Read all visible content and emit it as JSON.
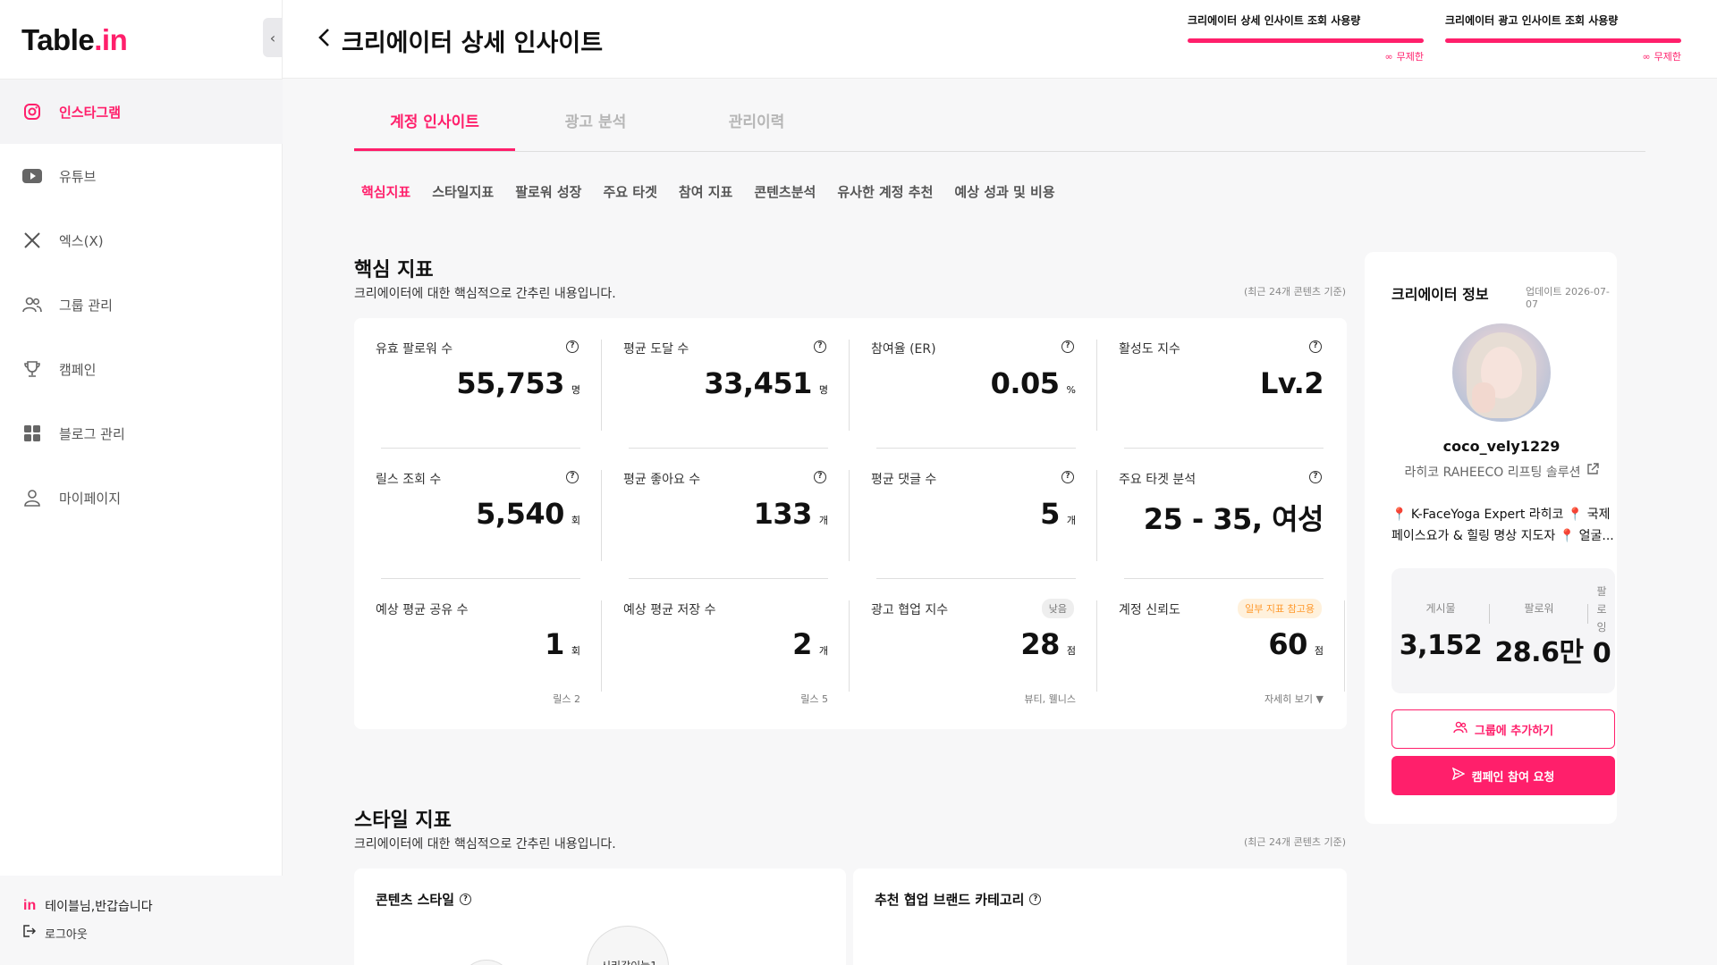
{
  "app": {
    "logo_main": "Table",
    "logo_dot": ".",
    "logo_suffix": "in"
  },
  "sidebar": {
    "items": [
      {
        "label": "인스타그램",
        "icon": "instagram-icon"
      },
      {
        "label": "유튜브",
        "icon": "youtube-icon"
      },
      {
        "label": "엑스(X)",
        "icon": "x-icon"
      },
      {
        "label": "그룹 관리",
        "icon": "group-icon"
      },
      {
        "label": "캠페인",
        "icon": "trophy-icon"
      },
      {
        "label": "블로그 관리",
        "icon": "grid-icon"
      },
      {
        "label": "마이페이지",
        "icon": "user-icon"
      }
    ],
    "active_index": 0,
    "footer": {
      "mini_logo": "in",
      "greeting": "테이블님,반갑습니다",
      "logout": "로그아웃"
    }
  },
  "header": {
    "title": "크리에이터 상세 인사이트",
    "usage": [
      {
        "label": "크리에이터 상세 인사이트 조회 사용량",
        "value": "무제한",
        "fill": 1.0
      },
      {
        "label": "크리에이터 광고 인사이트 조회 사용량",
        "value": "무제한",
        "fill": 1.0
      }
    ]
  },
  "tabs": [
    {
      "label": "계정 인사이트",
      "active": true
    },
    {
      "label": "광고 분석",
      "active": false
    },
    {
      "label": "관리이력",
      "active": false
    }
  ],
  "subtabs": [
    {
      "label": "핵심지표",
      "active": true
    },
    {
      "label": "스타일지표",
      "active": false
    },
    {
      "label": "팔로워 성장",
      "active": false
    },
    {
      "label": "주요 타겟",
      "active": false
    },
    {
      "label": "참여 지표",
      "active": false
    },
    {
      "label": "콘텐츠분석",
      "active": false
    },
    {
      "label": "유사한 계정 추천",
      "active": false
    },
    {
      "label": "예상 성과 및 비용",
      "active": false
    }
  ],
  "core": {
    "title": "핵심 지표",
    "desc": "크리에이터에 대한 핵심적으로 간추린 내용입니다.",
    "note": "(최근 24개 콘텐츠 기준)",
    "metrics": [
      {
        "label": "유효 팔로워 수",
        "value": "55,753",
        "unit": "명",
        "help": "?"
      },
      {
        "label": "평균 도달 수",
        "value": "33,451",
        "unit": "명",
        "help": "?"
      },
      {
        "label": "참여율 (ER)",
        "value": "0.05",
        "unit": "%",
        "help": "?"
      },
      {
        "label": "활성도 지수",
        "value": "Lv.2",
        "unit": "",
        "help": "?"
      },
      {
        "label": "릴스 조회 수",
        "value": "5,540",
        "unit": "회",
        "help": "?"
      },
      {
        "label": "평균 좋아요 수",
        "value": "133",
        "unit": "개",
        "help": "?"
      },
      {
        "label": "평균 댓글 수",
        "value": "5",
        "unit": "개",
        "help": "?"
      },
      {
        "label": "주요 타겟 분석",
        "value": "25 - 35, 여성",
        "unit": "",
        "help": "?"
      },
      {
        "label": "예상 평균 공유 수",
        "value": "1",
        "unit": "회",
        "sub": "릴스 2"
      },
      {
        "label": "예상 평균 저장 수",
        "value": "2",
        "unit": "개",
        "sub": "릴스 5"
      },
      {
        "label": "광고 협업 지수",
        "value": "28",
        "unit": "점",
        "sub": "뷰티, 웰니스",
        "badge": "낮음"
      },
      {
        "label": "계정 신뢰도",
        "value": "60",
        "unit": "점",
        "sub": "자세히 보기 ▼",
        "badge": "일부 지표 참고용"
      }
    ]
  },
  "style": {
    "title": "스타일 지표",
    "desc": "크리에이터에 대한 핵심적으로 간추린 내용입니다.",
    "note": "(최근 24개 콘텐츠 기준)",
    "card1_title": "콘텐츠 스타일",
    "card2_title": "추천 협업 브랜드 카테고리",
    "bubble_label": "시리각이늘1"
  },
  "creator": {
    "title": "크리에이터 정보",
    "updated": "업데이트 2026-07-07",
    "handle": "coco_vely1229",
    "company": "라히코 RAHEECO 리프팅 솔루션",
    "bio": "📍 K-FaceYoga Expert 라히코 📍 국제페이스요가 & 힐링 명상 지도자 📍 얼굴...",
    "stats": [
      {
        "label": "게시물",
        "value": "3,152"
      },
      {
        "label": "팔로워",
        "value": "28.6만"
      },
      {
        "label": "팔로잉",
        "value": "0"
      }
    ],
    "btn_group": "그룹에 추가하기",
    "btn_campaign": "캠페인 참여 요청"
  }
}
